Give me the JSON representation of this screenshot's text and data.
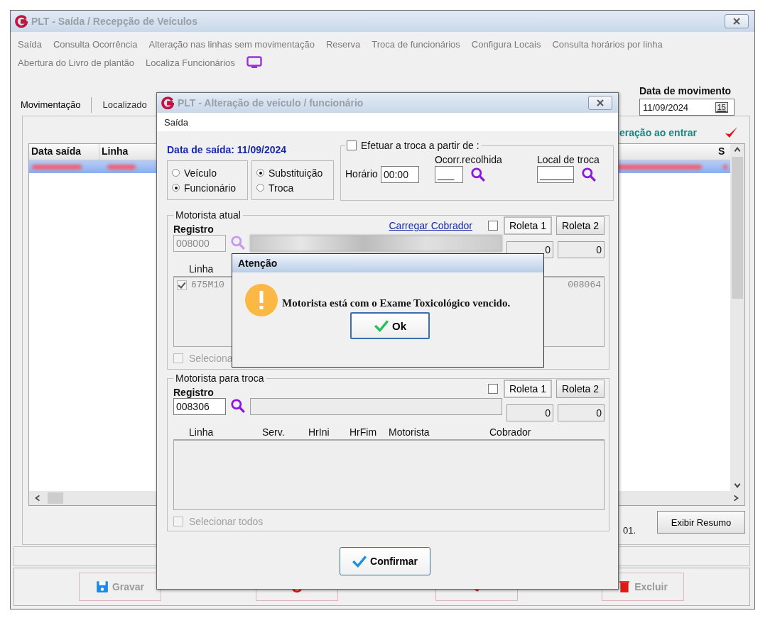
{
  "main_window": {
    "title": "PLT - Saída / Recepção de Veículos",
    "menu_rows": [
      [
        "Saída",
        "Consulta Ocorrência",
        "Alteração nas linhas sem movimentação",
        "Reserva",
        "Troca de funcionários",
        "Configura Locais",
        "Consulta horários por linha"
      ],
      [
        "Abertura do Livro de plantão",
        "Localiza Funcionários"
      ]
    ],
    "tabs": [
      {
        "label": "Movimentação",
        "selected": true
      },
      {
        "label": "Localizado",
        "selected": false
      }
    ],
    "date_label": "Data de movimento",
    "date_value": "11/09/2024",
    "calendar_button": "15",
    "notice": "eração ao entrar",
    "table": {
      "columns": [
        "Data saída",
        "Linha",
        "S"
      ]
    },
    "footer_text": "01.",
    "summary_button": "Exibir Resumo",
    "bottom_buttons": [
      {
        "kind": "save",
        "label": "Gravar"
      },
      {
        "kind": "cancel"
      },
      {
        "kind": "clear"
      },
      {
        "kind": "delete",
        "label": "Excluir"
      }
    ]
  },
  "dialog": {
    "title": "PLT - Alteração de veículo / funcionário",
    "menu": [
      "Saída"
    ],
    "date_line": "Data de saída: 11/09/2024",
    "target": [
      {
        "label": "Veículo",
        "selected": false
      },
      {
        "label": "Funcionário",
        "selected": true
      }
    ],
    "mode": [
      {
        "label": "Substituição",
        "selected": true
      },
      {
        "label": "Troca",
        "selected": false
      }
    ],
    "schedule": {
      "label": "Efetuar a troca a partir de :",
      "checked": false,
      "time_label": "Horário",
      "time_value": "00:00",
      "occurrence_label": "Ocorr.recolhida",
      "occurrence_value": "___",
      "place_label": "Local de troca",
      "place_value": "______"
    },
    "current_driver": {
      "legend": "Motorista atual",
      "registro_label": "Registro",
      "registro_value": "008000",
      "disabled": true,
      "link": "Carregar Cobrador",
      "checked": false,
      "roletas": [
        {
          "label": "Roleta 1",
          "selected": true
        },
        {
          "label": "Roleta 2",
          "selected": false
        }
      ],
      "counters": [
        "0",
        "0"
      ],
      "columns": [
        "Linha"
      ],
      "rows": [
        {
          "checked": true,
          "cells": [
            "675M10",
            "008064"
          ]
        }
      ],
      "select_all": {
        "label": "Seleciona",
        "checked": false,
        "disabled": true
      }
    },
    "swap_driver": {
      "legend": "Motorista para troca",
      "registro_label": "Registro",
      "registro_value": "008306",
      "disabled": false,
      "checked": false,
      "roletas": [
        {
          "label": "Roleta 1",
          "selected": true
        },
        {
          "label": "Roleta 2",
          "selected": false
        }
      ],
      "counters": [
        "0",
        "0"
      ],
      "columns": [
        "Linha",
        "Serv.",
        "HrIni",
        "HrFim",
        "Motorista",
        "Cobrador"
      ],
      "select_all": {
        "label": "Selecionar todos",
        "checked": false,
        "disabled": true
      }
    },
    "confirm_button": "Confirmar"
  },
  "alert": {
    "title": "Atenção",
    "message": "Motorista está com o Exame Toxicológico vencido.",
    "ok_button": "Ok"
  }
}
